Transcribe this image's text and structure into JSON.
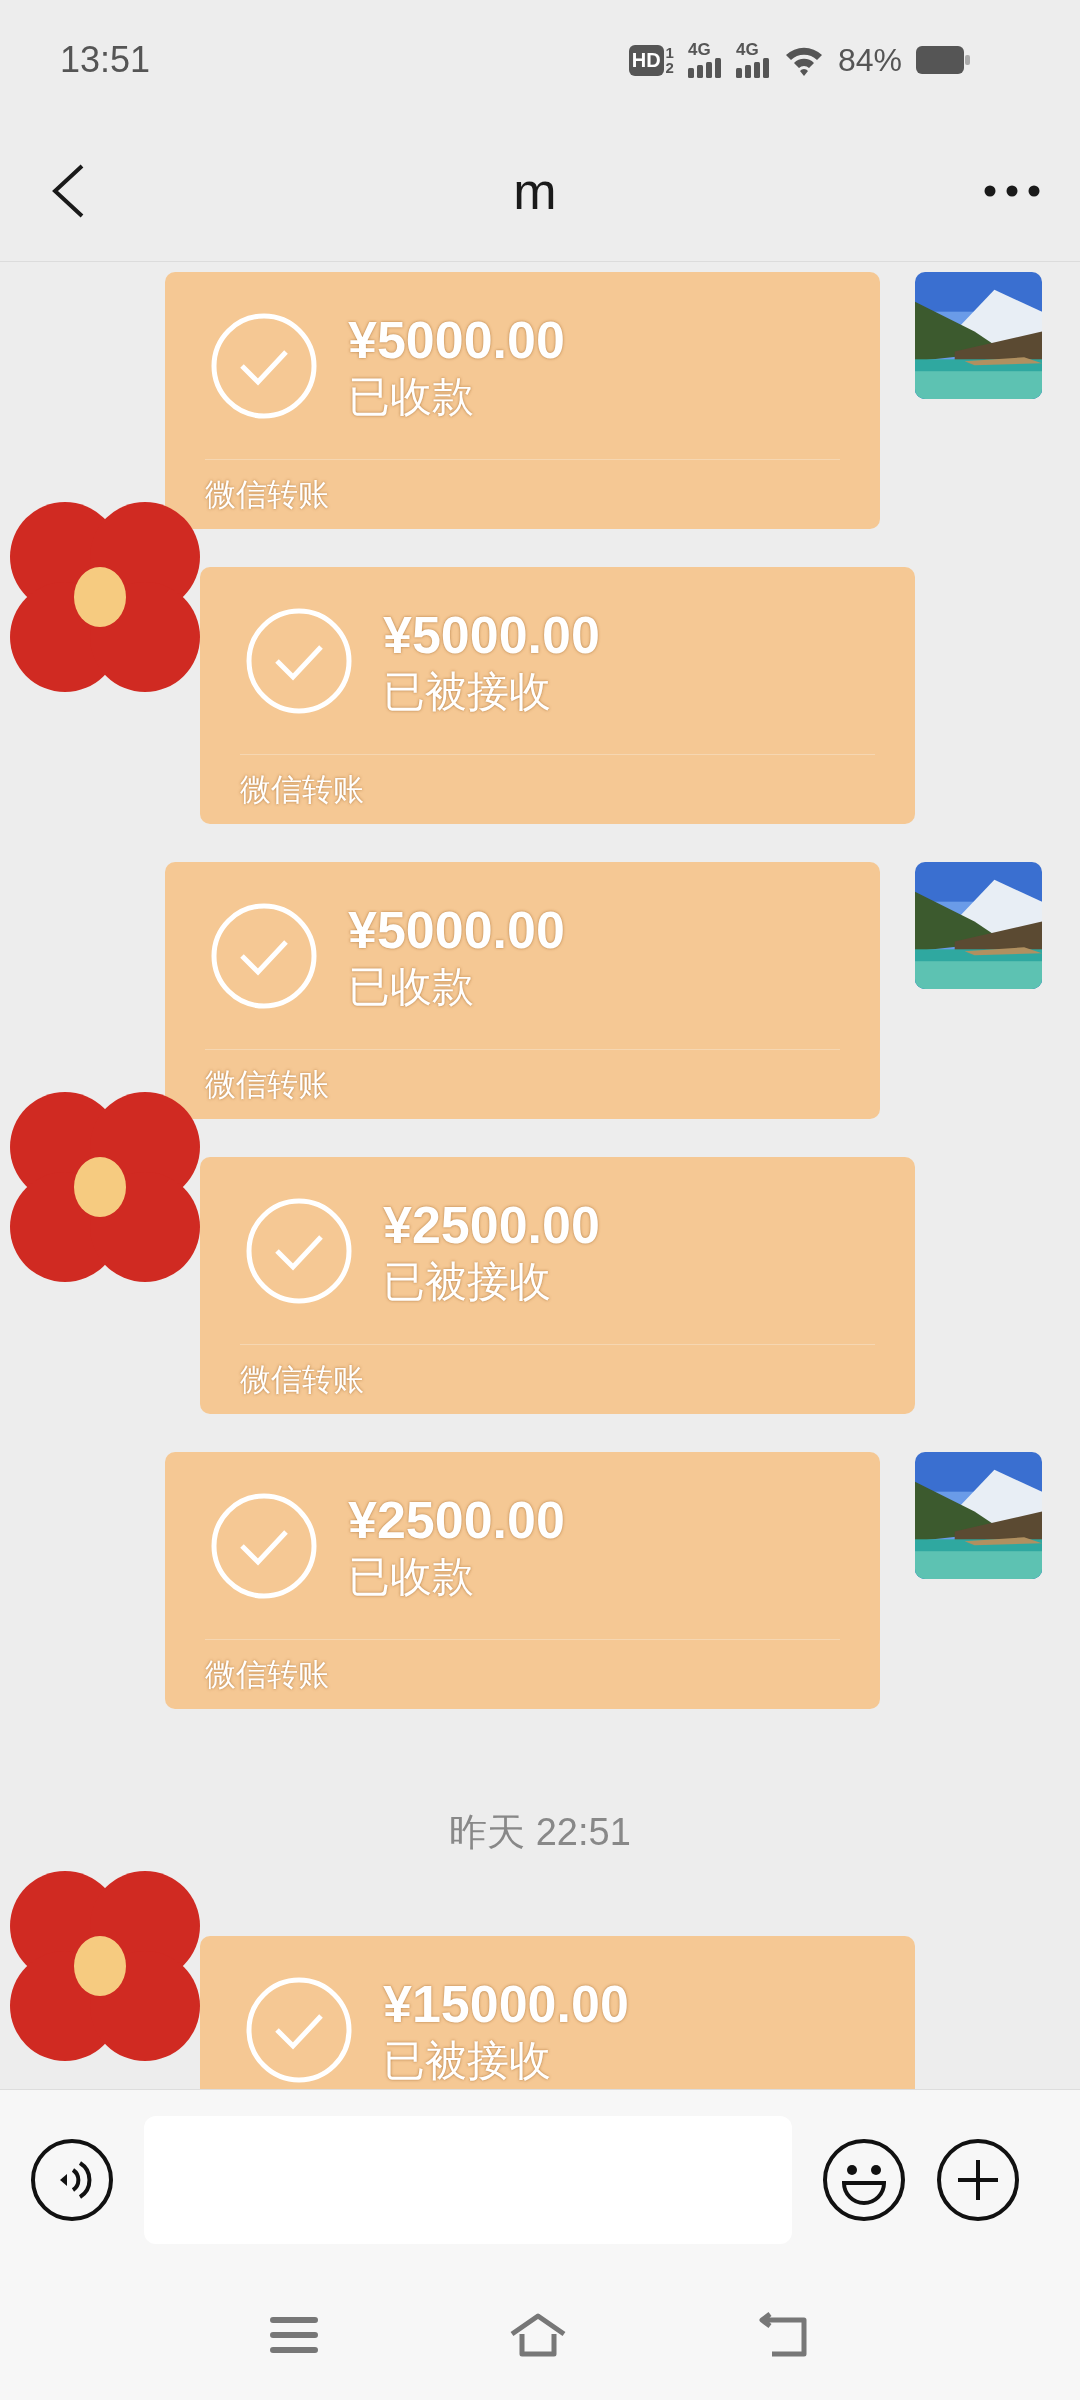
{
  "status_bar": {
    "time": "13:51",
    "hd": "HD",
    "hd_index": [
      "1",
      "2"
    ],
    "networks": [
      "4G",
      "4G"
    ],
    "battery": "84%"
  },
  "header": {
    "title": "m"
  },
  "messages": [
    {
      "kind": "sent",
      "amount": "¥5000.00",
      "status": "已收款",
      "footer": "微信转账"
    },
    {
      "kind": "received",
      "amount": "¥5000.00",
      "status": "已被接收",
      "footer": "微信转账"
    },
    {
      "kind": "sent",
      "amount": "¥5000.00",
      "status": "已收款",
      "footer": "微信转账"
    },
    {
      "kind": "received",
      "amount": "¥2500.00",
      "status": "已被接收",
      "footer": "微信转账"
    },
    {
      "kind": "sent",
      "amount": "¥2500.00",
      "status": "已收款",
      "footer": "微信转账"
    },
    {
      "kind": "timestamp",
      "text": "昨天 22:51"
    },
    {
      "kind": "received",
      "amount": "¥15000.00",
      "status": "已被接收"
    }
  ]
}
